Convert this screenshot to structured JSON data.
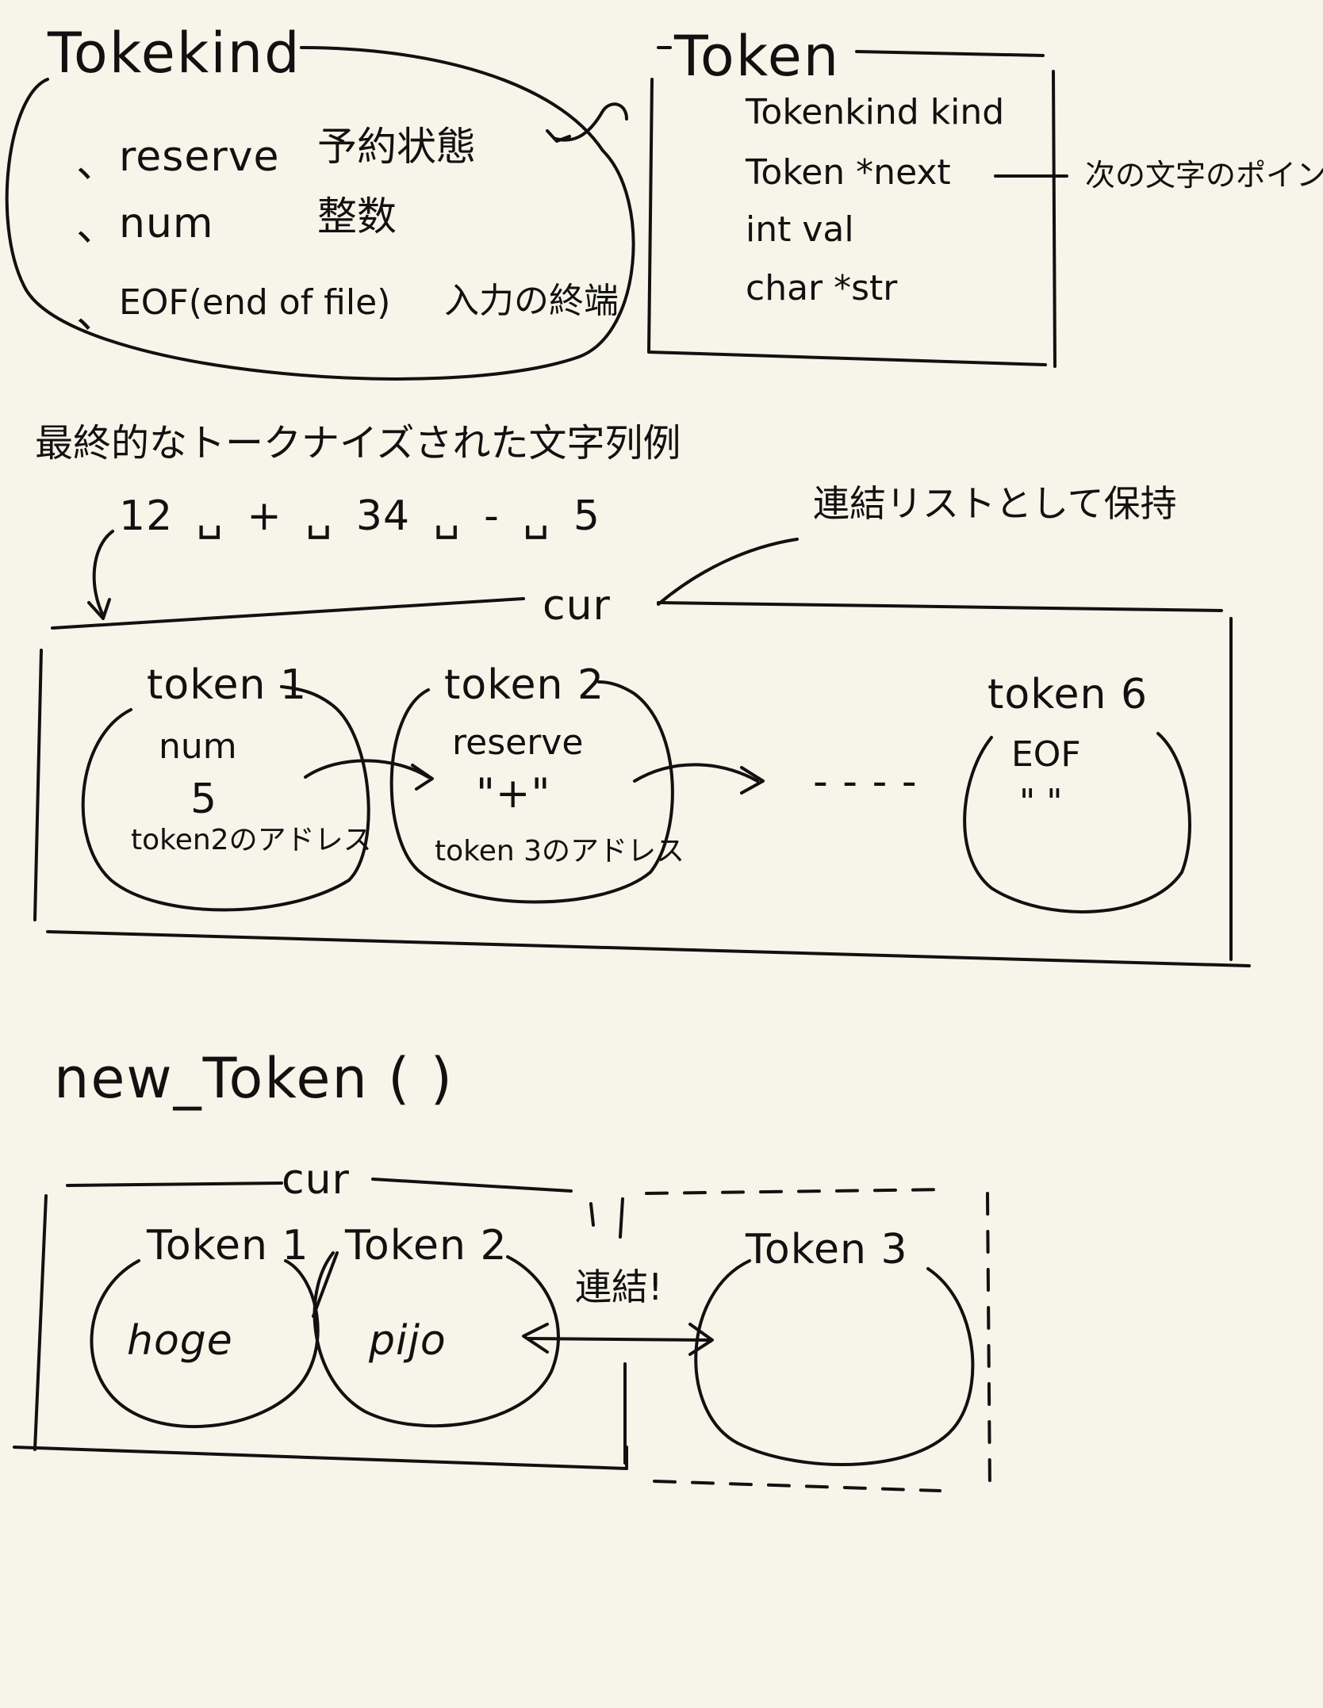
{
  "tokenkind": {
    "title": "Tokekind",
    "items": [
      {
        "bullet": "、",
        "name": "reserve",
        "desc": "予約状態"
      },
      {
        "bullet": "、",
        "name": "num",
        "desc": "整数"
      },
      {
        "bullet": "、",
        "name": "EOF(end of file)",
        "desc": "入力の終端"
      }
    ]
  },
  "token_struct": {
    "title": "Token",
    "fields": [
      "Tokenkind kind",
      "Token  *next",
      "int   val",
      "char *str"
    ],
    "next_note": "次の文字のポインタ"
  },
  "example": {
    "heading": "最終的なトークナイズされた文字列例",
    "expr": "12 ␣ + ␣ 34 ␣ - ␣ 5",
    "linked_note": "連結リストとして保持",
    "cur_label": "cur",
    "tokens": [
      {
        "title": "token 1",
        "kind": "num",
        "value": "5",
        "next": "token2のアドレス"
      },
      {
        "title": "token 2",
        "kind": "reserve",
        "value": "\"+\"",
        "next": "token 3のアドレス"
      },
      {
        "title": "token 6",
        "kind": "EOF",
        "value": "\" \"",
        "next": ""
      }
    ],
    "ellipsis": "- - - -"
  },
  "new_token": {
    "heading": "new_Token ( )",
    "cur_label": "cur",
    "tokens": [
      {
        "title": "Token 1",
        "value": "hoge"
      },
      {
        "title": "Token 2",
        "value": "pijo"
      },
      {
        "title": "Token 3",
        "value": ""
      }
    ],
    "link_label": "連結!"
  }
}
